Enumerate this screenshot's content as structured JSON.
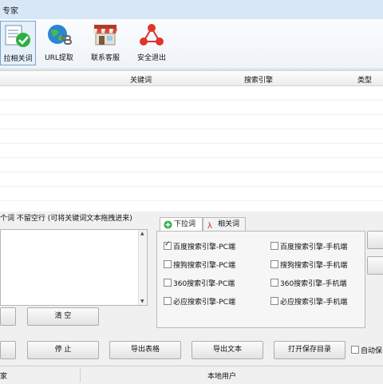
{
  "window": {
    "title_fragment": "专家"
  },
  "toolbar": {
    "items": [
      {
        "label": "拉相关词",
        "icon": "checklist-icon"
      },
      {
        "label": "URL提取",
        "icon": "globe-link-icon"
      },
      {
        "label": "联系客服",
        "icon": "shop-icon"
      },
      {
        "label": "安全退出",
        "icon": "exit-icon"
      }
    ]
  },
  "grid": {
    "columns": [
      "关键词",
      "搜索引擎",
      "类型"
    ]
  },
  "input": {
    "hint": "个词 不留空行 (可将关键词文本拖拽进来)",
    "clear_label": "清 空"
  },
  "tabs": [
    {
      "label": "下拉词",
      "icon": "plus-circle-icon"
    },
    {
      "label": "相关词",
      "icon": "related-icon"
    }
  ],
  "engines": [
    {
      "label": "百度搜索引擎-PC端",
      "checked": true
    },
    {
      "label": "百度搜索引擎-手机端",
      "checked": false
    },
    {
      "label": "搜狗搜索引擎-PC端",
      "checked": false
    },
    {
      "label": "搜狗搜索引擎-手机端",
      "checked": false
    },
    {
      "label": "360搜索引擎-PC端",
      "checked": false
    },
    {
      "label": "360搜索引擎-手机端",
      "checked": false
    },
    {
      "label": "必应搜索引擎-PC端",
      "checked": false
    },
    {
      "label": "必应搜索引擎-手机端",
      "checked": false
    }
  ],
  "actions": {
    "stop": "停 止",
    "export_table": "导出表格",
    "export_text": "导出文本",
    "open_dir": "打开保存目录",
    "auto_save": "自动保"
  },
  "status": {
    "left": "家",
    "user": "本地用户"
  },
  "colors": {
    "title_bar": "#d7e7f6",
    "selected_tool": "#e5f0fb",
    "accent_green": "#2fae43"
  }
}
